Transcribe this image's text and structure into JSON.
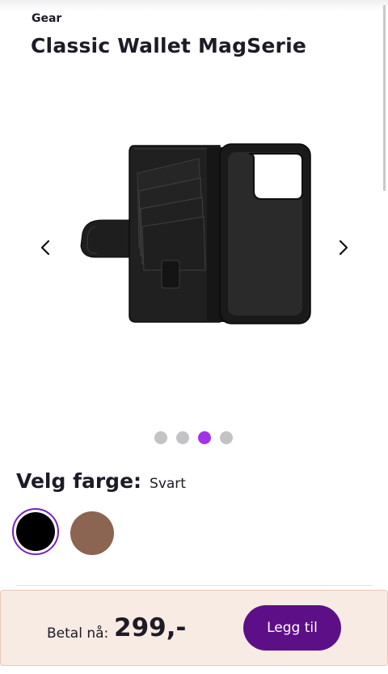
{
  "product": {
    "brand": "Gear",
    "title": "Classic Wallet MagSerie",
    "image_alt": "Black leather wallet phone case, open"
  },
  "carousel": {
    "total_images": 4,
    "active_index": 2,
    "prev_icon": "chevron-left-icon",
    "next_icon": "chevron-right-icon"
  },
  "color_picker": {
    "label": "Velg farge:",
    "selected": "Svart",
    "options": [
      {
        "name": "Svart",
        "hex": "#000000",
        "selected": true
      },
      {
        "name": "Brun",
        "hex": "#8b6452",
        "selected": false
      }
    ]
  },
  "checkout": {
    "pay_label": "Betal nå:",
    "price": "299,-",
    "cta_label": "Legg til"
  },
  "colors": {
    "accent": "#a333e6",
    "cta": "#5d0f88",
    "footer_bg": "#f7ebe3"
  }
}
